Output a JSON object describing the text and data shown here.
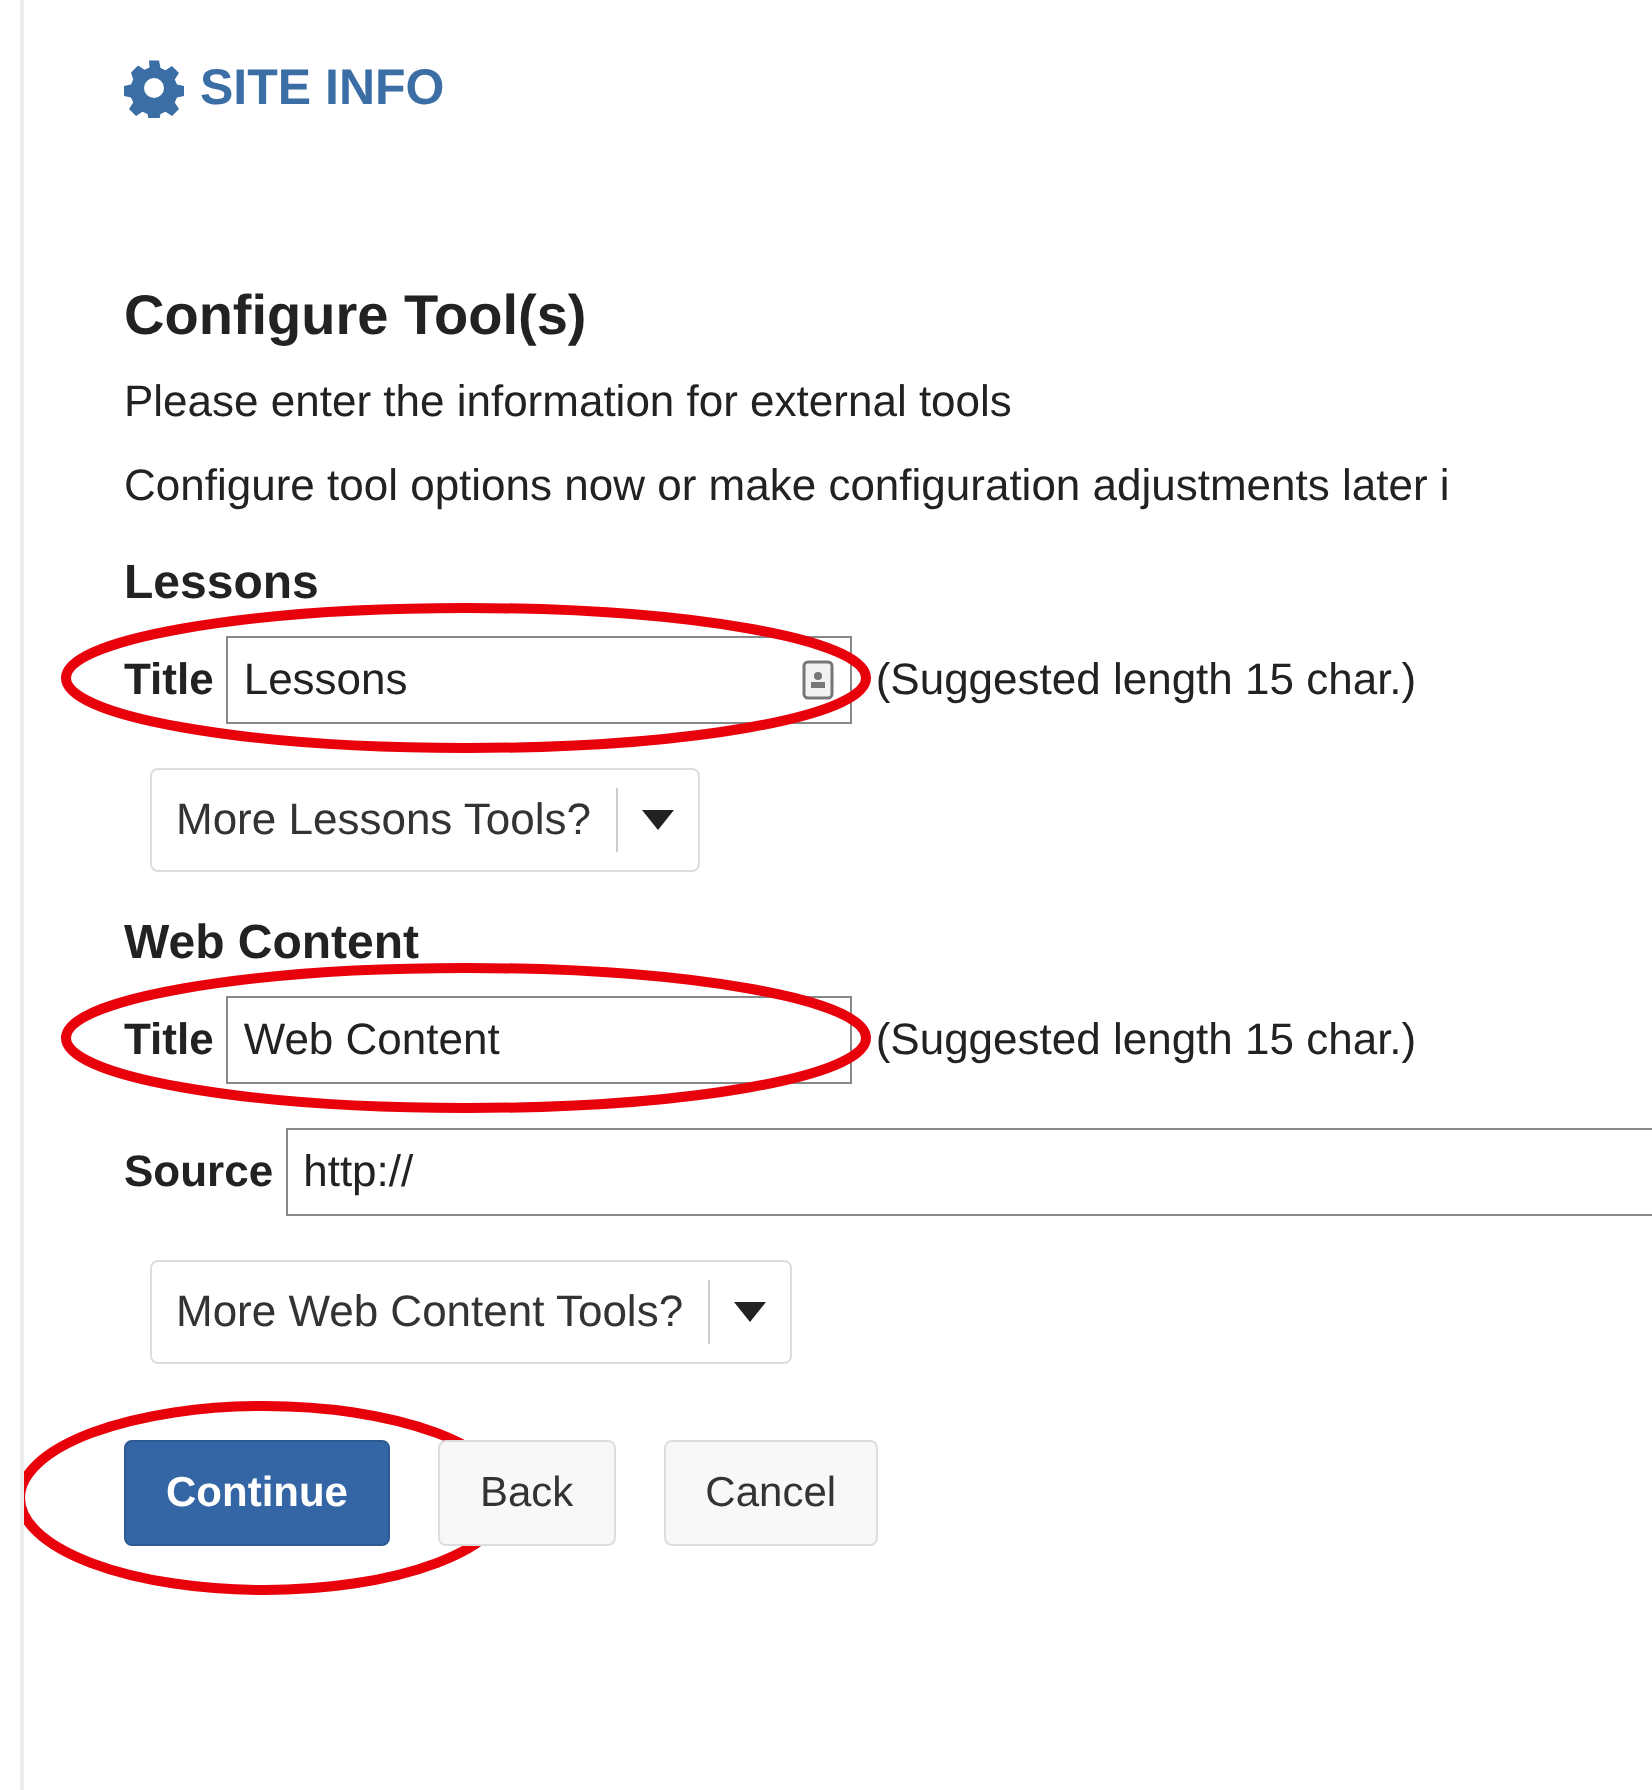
{
  "header": {
    "title": "SITE INFO"
  },
  "heading": "Configure Tool(s)",
  "intro": [
    "Please enter the information for external tools",
    "Configure tool options now or make configuration adjustments later i"
  ],
  "sections": [
    {
      "name": "Lessons",
      "title_label": "Title",
      "title_value": "Lessons",
      "title_field_icon": true,
      "title_highlighted": true,
      "hint": "(Suggested length 15 char.)",
      "more_tools": "More Lessons Tools?"
    },
    {
      "name": "Web Content",
      "title_label": "Title",
      "title_value": "Web Content",
      "title_field_icon": false,
      "title_highlighted": true,
      "hint": "(Suggested length 15 char.)",
      "source_label": "Source",
      "source_value": "http://",
      "more_tools": "More Web Content Tools?"
    }
  ],
  "buttons": [
    {
      "label": "Continue",
      "kind": "primary",
      "highlighted": true
    },
    {
      "label": "Back",
      "kind": "default",
      "highlighted": false
    },
    {
      "label": "Cancel",
      "kind": "default",
      "highlighted": false
    }
  ]
}
